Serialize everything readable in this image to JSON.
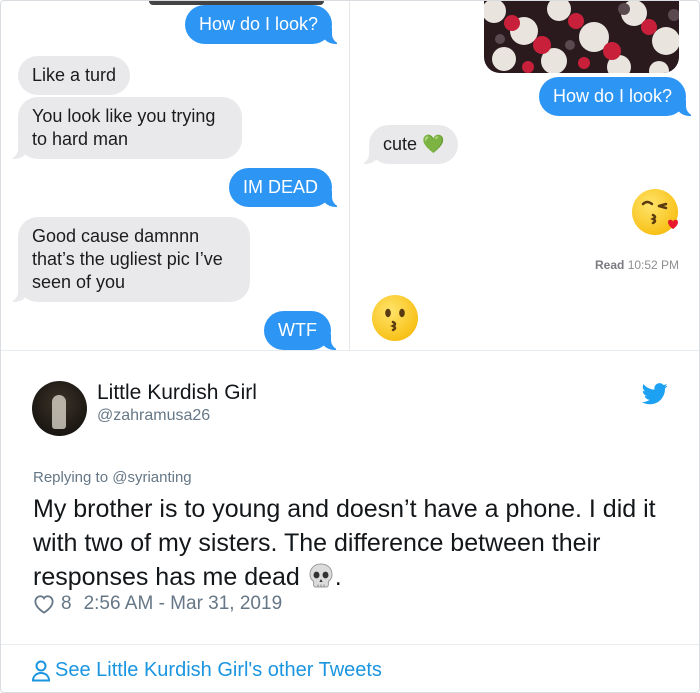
{
  "left_chat": {
    "messages": [
      {
        "from": "me",
        "text": "How do I look?"
      },
      {
        "from": "them",
        "text": "Like a turd"
      },
      {
        "from": "them",
        "text": "You look like you trying\nto hard man"
      },
      {
        "from": "me",
        "text": "IM DEAD"
      },
      {
        "from": "them",
        "text": "Good cause damnnn\nthat’s the ugliest pic I’ve\nseen of you"
      },
      {
        "from": "me",
        "text": "WTF"
      }
    ]
  },
  "right_chat": {
    "messages": [
      {
        "from": "me",
        "text": "How do I look?"
      },
      {
        "from": "them",
        "text": "cute 💚"
      }
    ],
    "reactions": [
      "kissing-face-with-heart-emoji",
      "kissing-face-emoji"
    ],
    "read_label": "Read",
    "read_time": "10:52 PM"
  },
  "tweet": {
    "display_name": "Little Kurdish Girl",
    "handle": "@zahramusa26",
    "replying_prefix": "Replying to",
    "replying_to": "@syrianting",
    "text": "My brother is to young and doesn’t have a phone. I did it with two of my sisters. The difference between their responses has me dead",
    "text_suffix": ".",
    "likes": "8",
    "timestamp": "2:56 AM - Mar 31, 2019",
    "see_more": "See Little Kurdish Girl's other Tweets"
  },
  "colors": {
    "imessage_blue": "#2d95f3",
    "imessage_gray": "#e9e9eb",
    "twitter_blue": "#1b95e0"
  },
  "icons": [
    "twitter-bird-icon",
    "heart-icon",
    "person-icon",
    "skull-emoji"
  ]
}
